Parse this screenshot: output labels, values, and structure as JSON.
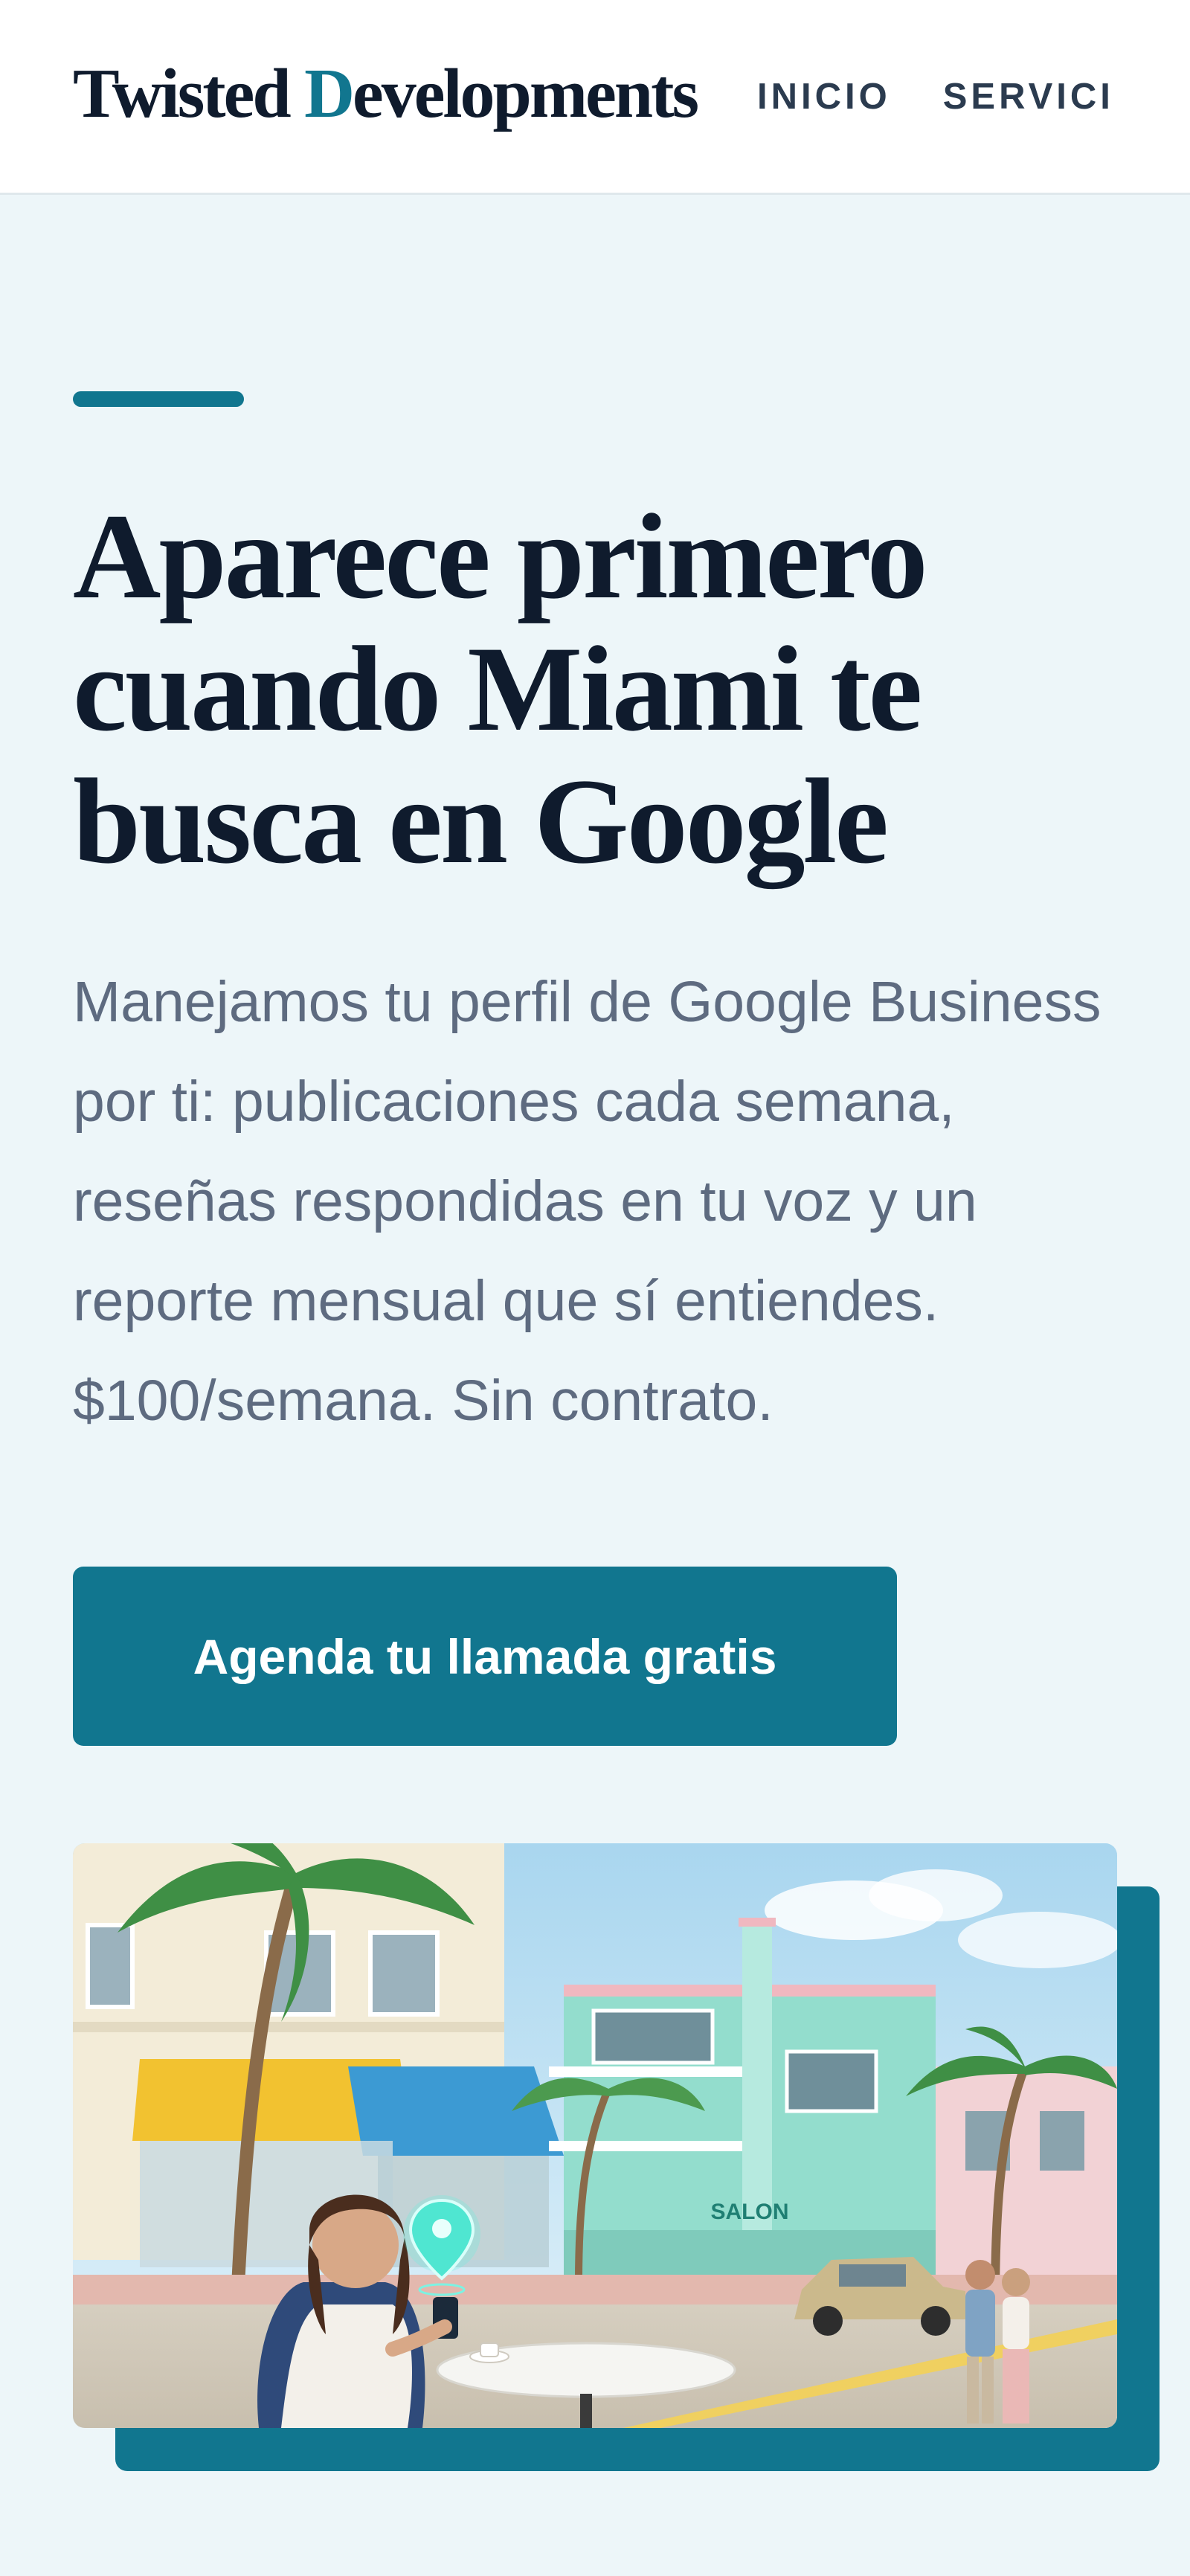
{
  "header": {
    "brand": {
      "part1": "Twisted ",
      "accent_letter": "D",
      "part2": "evelopments"
    },
    "nav": [
      {
        "label": "INICIO"
      },
      {
        "label": "SERVICI"
      }
    ]
  },
  "hero": {
    "headline": "Aparece primero cuando Miami te busca en Google",
    "subtext": "Manejamos tu perfil de Google Business por ti: publicaciones cada semana, reseñas respondidas en tu voz y un reporte mensual que sí entiendes. $100/semana. Sin contrato.",
    "cta_label": "Agenda tu llamada gratis",
    "image": {
      "storefront_sign": "SALON",
      "icon": "map-pin-icon"
    }
  },
  "colors": {
    "accent": "#11768f",
    "heading": "#0f1b2d",
    "body_text": "#5e6b80",
    "background": "#edf6f9"
  }
}
